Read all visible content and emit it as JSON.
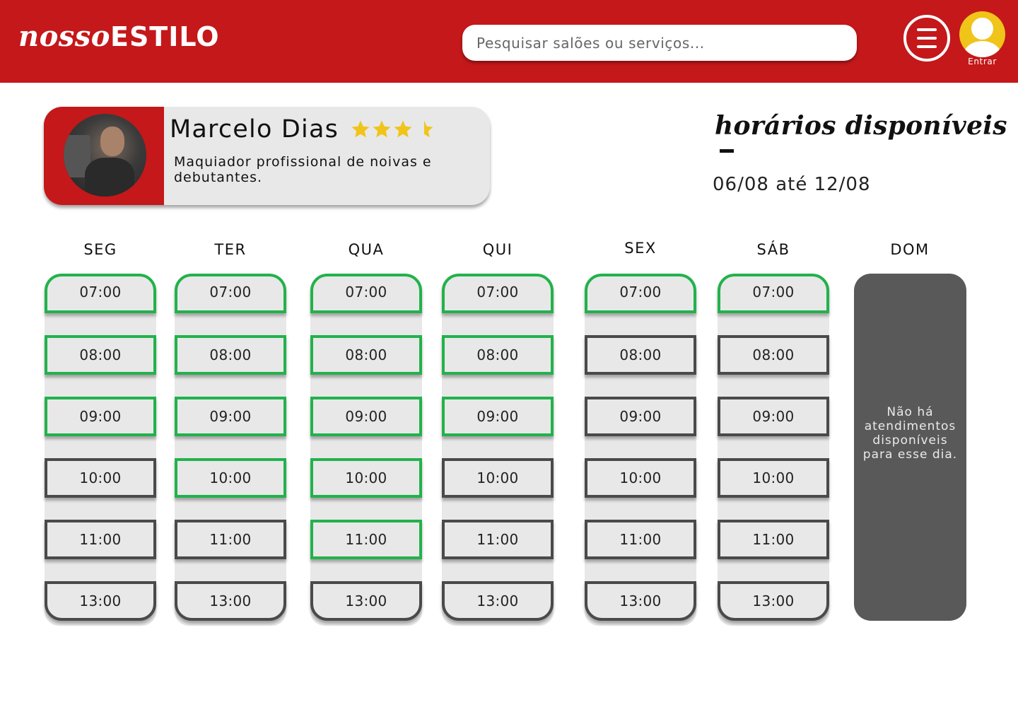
{
  "header": {
    "logo_part1": "nosso",
    "logo_part2": "ESTILO",
    "search_placeholder": "Pesquisar salões ou serviços...",
    "menu_icon": "hamburger-menu-icon",
    "user_icon": "user-avatar-icon",
    "login_label": "Entrar"
  },
  "profile": {
    "name": "Marcelo Dias",
    "rating": 3.5,
    "rating_max": 4,
    "description": "Maquiador profissional de noivas e debutantes."
  },
  "schedule": {
    "title": "horários disponíveis",
    "date_range": "06/08 até 12/08",
    "days": [
      {
        "label": "SEG",
        "slots": [
          {
            "time": "07:00",
            "available": true
          },
          {
            "time": "08:00",
            "available": true
          },
          {
            "time": "09:00",
            "available": true
          },
          {
            "time": "10:00",
            "available": false
          },
          {
            "time": "11:00",
            "available": false
          },
          {
            "time": "13:00",
            "available": false
          }
        ]
      },
      {
        "label": "TER",
        "slots": [
          {
            "time": "07:00",
            "available": true
          },
          {
            "time": "08:00",
            "available": true
          },
          {
            "time": "09:00",
            "available": true
          },
          {
            "time": "10:00",
            "available": true
          },
          {
            "time": "11:00",
            "available": false
          },
          {
            "time": "13:00",
            "available": false
          }
        ]
      },
      {
        "label": "QUA",
        "slots": [
          {
            "time": "07:00",
            "available": true
          },
          {
            "time": "08:00",
            "available": true
          },
          {
            "time": "09:00",
            "available": true
          },
          {
            "time": "10:00",
            "available": true
          },
          {
            "time": "11:00",
            "available": true
          },
          {
            "time": "13:00",
            "available": false
          }
        ]
      },
      {
        "label": "QUI",
        "slots": [
          {
            "time": "07:00",
            "available": true
          },
          {
            "time": "08:00",
            "available": true
          },
          {
            "time": "09:00",
            "available": true
          },
          {
            "time": "10:00",
            "available": false
          },
          {
            "time": "11:00",
            "available": false
          },
          {
            "time": "13:00",
            "available": false
          }
        ]
      },
      {
        "label": "SEX",
        "slots": [
          {
            "time": "07:00",
            "available": true
          },
          {
            "time": "08:00",
            "available": false
          },
          {
            "time": "09:00",
            "available": false
          },
          {
            "time": "10:00",
            "available": false
          },
          {
            "time": "11:00",
            "available": false
          },
          {
            "time": "13:00",
            "available": false
          }
        ]
      },
      {
        "label": "SÁB",
        "slots": [
          {
            "time": "07:00",
            "available": true
          },
          {
            "time": "08:00",
            "available": false
          },
          {
            "time": "09:00",
            "available": false
          },
          {
            "time": "10:00",
            "available": false
          },
          {
            "time": "11:00",
            "available": false
          },
          {
            "time": "13:00",
            "available": false
          }
        ]
      },
      {
        "label": "DOM",
        "slots": [],
        "unavailable_message": "Não há atendimentos disponíveis para esse dia."
      }
    ]
  },
  "colors": {
    "brand_red": "#c4181a",
    "available_green": "#22b24c",
    "unavailable_gray": "#4a4a4a",
    "star_yellow": "#f0c419"
  }
}
